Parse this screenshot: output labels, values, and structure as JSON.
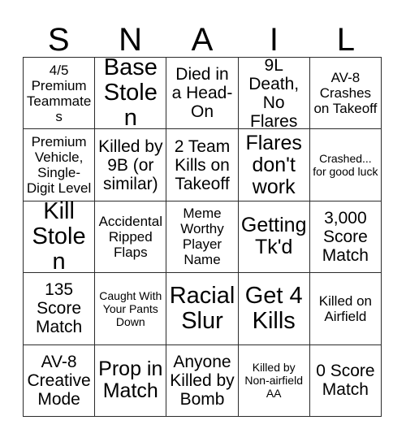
{
  "card": {
    "title_letters": [
      "S",
      "N",
      "A",
      "I",
      "L"
    ],
    "columns": 5,
    "rows": 5,
    "border_color": "#2b2b2b",
    "background_color": "#ffffff",
    "text_color": "#000000"
  },
  "cells": [
    {
      "text": "4/5 Premium Teammates",
      "size": "sm"
    },
    {
      "text": "Base Stolen",
      "size": "xl"
    },
    {
      "text": "Died in a Head-On",
      "size": "md"
    },
    {
      "text": "9L Death, No Flares",
      "size": "md"
    },
    {
      "text": "AV-8 Crashes on Takeoff",
      "size": "sm"
    },
    {
      "text": "Premium Vehicle, Single-Digit Level",
      "size": "sm"
    },
    {
      "text": "Killed by 9B (or similar)",
      "size": "md"
    },
    {
      "text": "2 Team Kills on Takeoff",
      "size": "md"
    },
    {
      "text": "Flares don't work",
      "size": "lg"
    },
    {
      "text": "Crashed... for good luck",
      "size": "xs"
    },
    {
      "text": "Kill Stolen",
      "size": "xl"
    },
    {
      "text": "Accidental Ripped Flaps",
      "size": "sm"
    },
    {
      "text": "Meme Worthy Player Name",
      "size": "sm"
    },
    {
      "text": "Getting Tk'd",
      "size": "lg"
    },
    {
      "text": "3,000 Score Match",
      "size": "md"
    },
    {
      "text": "135 Score Match",
      "size": "md"
    },
    {
      "text": "Caught With Your Pants Down",
      "size": "xs"
    },
    {
      "text": "Racial Slur",
      "size": "xl"
    },
    {
      "text": "Get 4 Kills",
      "size": "xl"
    },
    {
      "text": "Killed on Airfield",
      "size": "sm"
    },
    {
      "text": "AV-8 Creative Mode",
      "size": "md"
    },
    {
      "text": "Prop in Match",
      "size": "lg"
    },
    {
      "text": "Anyone Killed by Bomb",
      "size": "md"
    },
    {
      "text": "Killed by Non-airfield AA",
      "size": "xs"
    },
    {
      "text": "0 Score Match",
      "size": "md"
    }
  ]
}
